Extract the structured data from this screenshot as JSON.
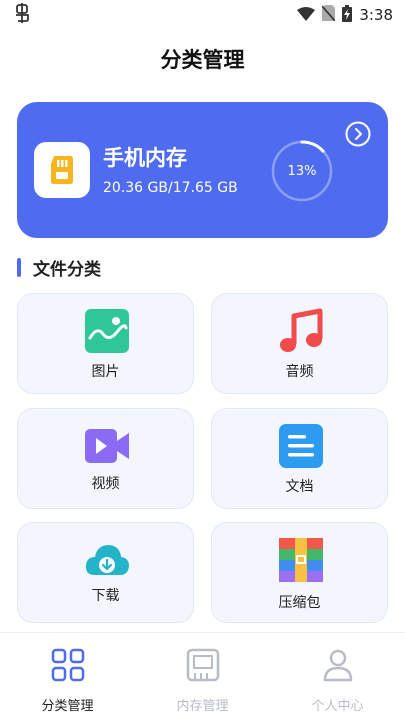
{
  "status_bar": {
    "time": "3:38",
    "left_icon": "debug-bug-icon",
    "icons": [
      "wifi-icon",
      "no-sim-icon",
      "battery-charging-icon"
    ]
  },
  "header": {
    "title": "分类管理"
  },
  "storage": {
    "name": "手机内存",
    "size_text": "20.36 GB/17.65 GB",
    "percent_text": "13%",
    "usage_fraction": 0.13,
    "icon": "sd-card-icon",
    "card_color": "#4f6cf0"
  },
  "section": {
    "title": "文件分类",
    "accent": "#4f6cf0"
  },
  "categories": [
    {
      "label": "图片",
      "icon": "image-icon"
    },
    {
      "label": "音频",
      "icon": "music-note-icon"
    },
    {
      "label": "视频",
      "icon": "video-camera-icon"
    },
    {
      "label": "文档",
      "icon": "document-icon"
    },
    {
      "label": "下载",
      "icon": "cloud-download-icon"
    },
    {
      "label": "压缩包",
      "icon": "archive-icon"
    }
  ],
  "bottom_nav": {
    "items": [
      {
        "label": "分类管理",
        "icon": "grid-icon",
        "active": true
      },
      {
        "label": "内存管理",
        "icon": "memory-chip-icon",
        "active": false
      },
      {
        "label": "个人中心",
        "icon": "person-icon",
        "active": false
      }
    ],
    "active_color": "#4f6cf0",
    "inactive_color": "#b8bcc6"
  }
}
